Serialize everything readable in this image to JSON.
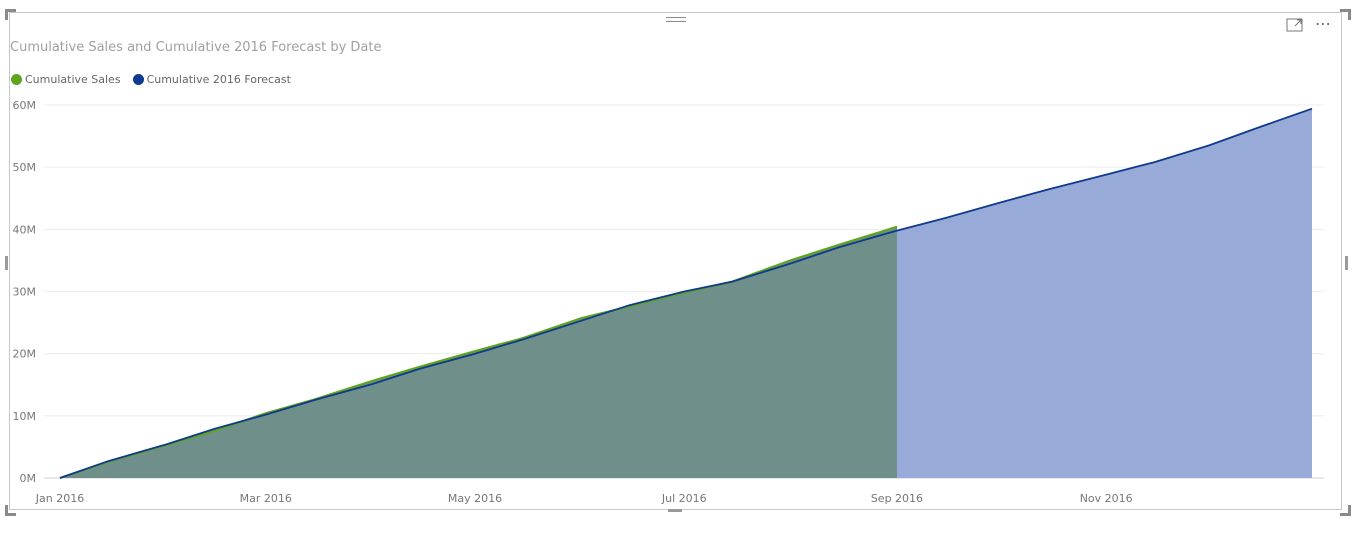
{
  "visual": {
    "title": "Cumulative Sales and Cumulative 2016 Forecast by Date",
    "icons": {
      "focus": "focus-mode-icon",
      "more": "more-options-icon",
      "grip": "drag-handle-icon"
    }
  },
  "legend": [
    {
      "name": "Cumulative Sales",
      "color": "#5fa31e"
    },
    {
      "name": "Cumulative 2016 Forecast",
      "color": "#0f3a8e"
    }
  ],
  "chart_data": {
    "type": "area",
    "title": "Cumulative Sales and Cumulative 2016 Forecast by Date",
    "xlabel": "",
    "ylabel": "",
    "x_ticks": [
      "Jan 2016",
      "Mar 2016",
      "May 2016",
      "Jul 2016",
      "Sep 2016",
      "Nov 2016"
    ],
    "y_ticks": [
      "0M",
      "10M",
      "20M",
      "30M",
      "40M",
      "50M",
      "60M"
    ],
    "ylim": [
      0,
      60
    ],
    "y_unit": "M",
    "xlim": [
      "2016-01-01",
      "2016-12-31"
    ],
    "grid": true,
    "legend_position": "top-left",
    "series": [
      {
        "name": "Cumulative Sales",
        "color": "#5fa31e",
        "fill": "#6f8f8a",
        "x": [
          "2016-01-01",
          "2016-01-15",
          "2016-02-01",
          "2016-02-15",
          "2016-03-01",
          "2016-03-15",
          "2016-04-01",
          "2016-04-15",
          "2016-05-01",
          "2016-05-15",
          "2016-06-01",
          "2016-06-15",
          "2016-07-01",
          "2016-07-15",
          "2016-08-01",
          "2016-08-15",
          "2016-09-01"
        ],
        "values": [
          0,
          2.6,
          5.3,
          7.6,
          10.4,
          12.6,
          15.6,
          17.9,
          20.4,
          22.5,
          25.7,
          27.6,
          29.8,
          31.6,
          35.0,
          37.5,
          40.4
        ]
      },
      {
        "name": "Cumulative 2016 Forecast",
        "color": "#0f3a8e",
        "fill": "#98abd8",
        "x": [
          "2016-01-01",
          "2016-01-15",
          "2016-02-01",
          "2016-02-15",
          "2016-03-01",
          "2016-03-15",
          "2016-04-01",
          "2016-04-15",
          "2016-05-01",
          "2016-05-15",
          "2016-06-01",
          "2016-06-15",
          "2016-07-01",
          "2016-07-15",
          "2016-08-01",
          "2016-08-15",
          "2016-09-01",
          "2016-09-15",
          "2016-10-01",
          "2016-10-15",
          "2016-11-01",
          "2016-11-15",
          "2016-12-01",
          "2016-12-15",
          "2016-12-31"
        ],
        "values": [
          0,
          2.7,
          5.4,
          7.9,
          10.2,
          12.5,
          15.1,
          17.6,
          20.0,
          22.3,
          25.3,
          27.8,
          30.0,
          31.6,
          34.5,
          37.1,
          39.8,
          41.8,
          44.3,
          46.4,
          48.8,
          50.8,
          53.5,
          56.3,
          59.4
        ]
      }
    ]
  }
}
